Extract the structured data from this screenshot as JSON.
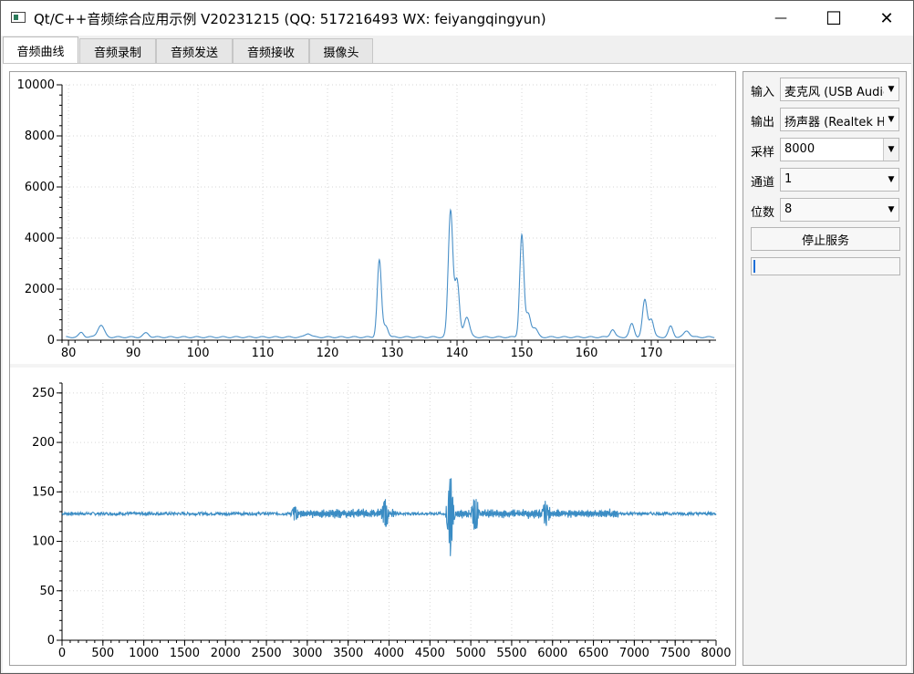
{
  "window": {
    "title": "Qt/C++音频综合应用示例 V20231215 (QQ: 517216493 WX: feiyangqingyun)",
    "minimize_glyph": "—",
    "maximize_glyph": "☐",
    "close_glyph": "✕"
  },
  "tabs": [
    {
      "label": "音频曲线",
      "active": true
    },
    {
      "label": "音频录制",
      "active": false
    },
    {
      "label": "音频发送",
      "active": false
    },
    {
      "label": "音频接收",
      "active": false
    },
    {
      "label": "摄像头",
      "active": false
    }
  ],
  "panel": {
    "input_label": "输入",
    "input_value": "麦克风 (USB Audio",
    "output_label": "输出",
    "output_value": "扬声器 (Realtek H",
    "sample_label": "采样",
    "sample_value": "8000",
    "channel_label": "通道",
    "channel_value": "1",
    "bits_label": "位数",
    "bits_value": "8",
    "stop_button": "停止服务",
    "progress": 0
  },
  "chart_data": [
    {
      "type": "line",
      "color": "#4a90c8",
      "grid": true,
      "xlim": [
        79,
        180
      ],
      "ylim": [
        0,
        10000
      ],
      "xticks": [
        "80",
        "90",
        "100",
        "110",
        "120",
        "130",
        "140",
        "150",
        "160",
        "170"
      ],
      "yticks": [
        "0",
        "2000",
        "4000",
        "6000",
        "8000",
        "10000"
      ],
      "baseline": 120,
      "peaks": [
        {
          "x": 82,
          "y": 180,
          "w": 0.5
        },
        {
          "x": 85,
          "y": 470,
          "w": 0.7
        },
        {
          "x": 92,
          "y": 160,
          "w": 0.6
        },
        {
          "x": 117,
          "y": 150,
          "w": 0.6
        },
        {
          "x": 128,
          "y": 3000,
          "w": 0.45
        },
        {
          "x": 129,
          "y": 450,
          "w": 0.5
        },
        {
          "x": 139,
          "y": 4950,
          "w": 0.5
        },
        {
          "x": 140,
          "y": 2200,
          "w": 0.5
        },
        {
          "x": 141.5,
          "y": 800,
          "w": 0.6
        },
        {
          "x": 150,
          "y": 4000,
          "w": 0.45
        },
        {
          "x": 151,
          "y": 900,
          "w": 0.5
        },
        {
          "x": 152,
          "y": 350,
          "w": 0.6
        },
        {
          "x": 164,
          "y": 300,
          "w": 0.5
        },
        {
          "x": 167,
          "y": 520,
          "w": 0.5
        },
        {
          "x": 169,
          "y": 1450,
          "w": 0.5
        },
        {
          "x": 170,
          "y": 700,
          "w": 0.5
        },
        {
          "x": 173,
          "y": 420,
          "w": 0.5
        },
        {
          "x": 175.5,
          "y": 250,
          "w": 0.6
        }
      ]
    },
    {
      "type": "line",
      "color": "#3a8cc4",
      "grid": true,
      "xlim": [
        0,
        8000
      ],
      "ylim": [
        0,
        260
      ],
      "xticks": [
        "0",
        "500",
        "1000",
        "1500",
        "2000",
        "2500",
        "3000",
        "3500",
        "4000",
        "4500",
        "5000",
        "5500",
        "6000",
        "6500",
        "7000",
        "7500",
        "8000"
      ],
      "yticks": [
        "0",
        "50",
        "100",
        "150",
        "200",
        "250"
      ],
      "baseline": 128,
      "noise": 1.5,
      "bursts": [
        {
          "x": 2850,
          "amp": 6
        },
        {
          "x": 3950,
          "amp": 12
        },
        {
          "x": 4750,
          "amp": 36
        },
        {
          "x": 5050,
          "amp": 15
        },
        {
          "x": 5920,
          "amp": 10
        }
      ],
      "wobble_ranges": [
        [
          2850,
          4100
        ],
        [
          4750,
          6800
        ]
      ]
    }
  ]
}
